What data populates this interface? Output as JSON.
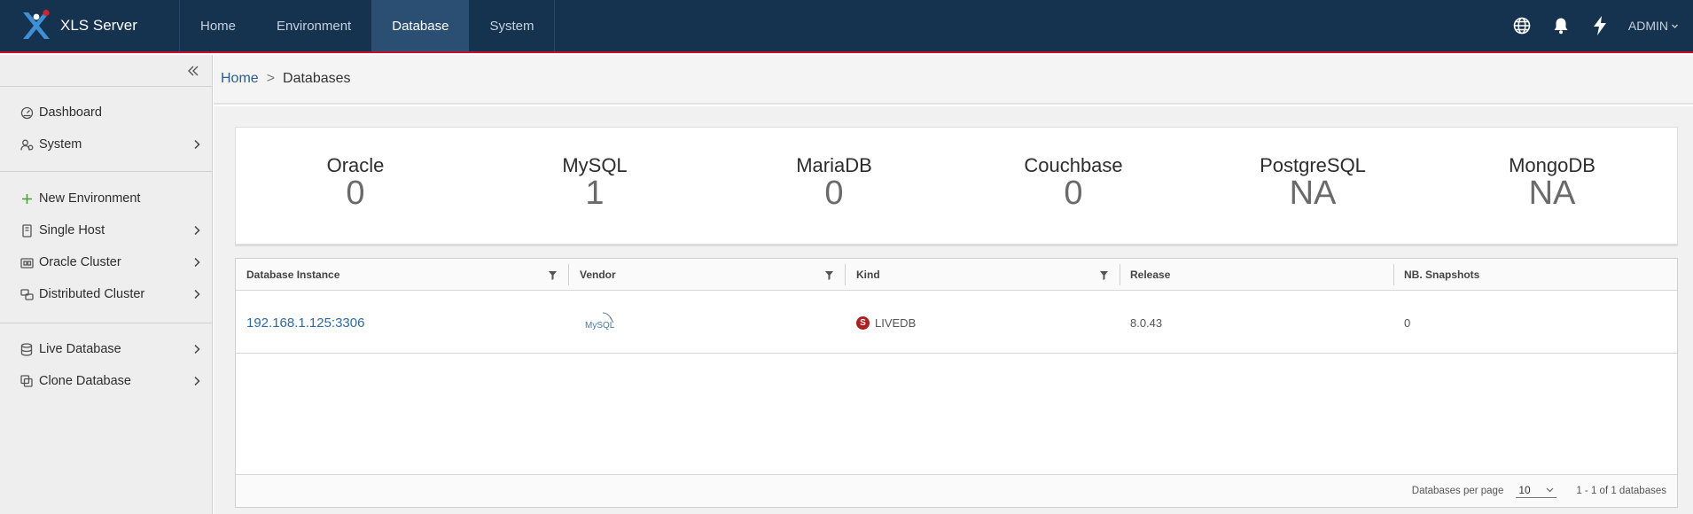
{
  "app": {
    "title": "XLS Server"
  },
  "header": {
    "tabs": [
      {
        "label": "Home",
        "active": false
      },
      {
        "label": "Environment",
        "active": false
      },
      {
        "label": "Database",
        "active": true
      },
      {
        "label": "System",
        "active": false
      }
    ],
    "icons": [
      "globe-icon",
      "bell-icon",
      "lightning-icon"
    ],
    "user": "ADMIN"
  },
  "sidebar": {
    "items": [
      {
        "label": "Dashboard",
        "icon": "dashboard-icon",
        "has_children": false
      },
      {
        "label": "System",
        "icon": "system-users-icon",
        "has_children": true
      },
      {
        "label": "New Environment",
        "icon": "plus-icon",
        "has_children": false
      },
      {
        "label": "Single Host",
        "icon": "host-icon",
        "has_children": true
      },
      {
        "label": "Oracle Cluster",
        "icon": "cluster-icon",
        "has_children": true
      },
      {
        "label": "Distributed Cluster",
        "icon": "distributed-cluster-icon",
        "has_children": true
      },
      {
        "label": "Live Database",
        "icon": "database-icon",
        "has_children": true
      },
      {
        "label": "Clone Database",
        "icon": "clone-icon",
        "has_children": true
      }
    ]
  },
  "breadcrumb": {
    "home": "Home",
    "separator": ">",
    "current": "Databases"
  },
  "stats": [
    {
      "label": "Oracle",
      "value": "0"
    },
    {
      "label": "MySQL",
      "value": "1"
    },
    {
      "label": "MariaDB",
      "value": "0"
    },
    {
      "label": "Couchbase",
      "value": "0"
    },
    {
      "label": "PostgreSQL",
      "value": "NA"
    },
    {
      "label": "MongoDB",
      "value": "NA"
    }
  ],
  "table": {
    "columns": [
      "Database Instance",
      "Vendor",
      "Kind",
      "Release",
      "NB. Snapshots"
    ],
    "rows": [
      {
        "instance": "192.168.1.125:3306",
        "vendor_logo_text": "MySQL",
        "kind_badge": "S",
        "kind": "LIVEDB",
        "release": "8.0.43",
        "snapshots": "0"
      }
    ],
    "footer": {
      "per_page_label": "Databases per page",
      "per_page_value": "10",
      "range": "1 - 1 of 1 databases"
    }
  },
  "colors": {
    "header_bg": "#15324f",
    "active_tab": "#2b4e73",
    "accent_red": "#c8102e",
    "link": "#2a6aa8",
    "kind_badge": "#b01e1e"
  }
}
